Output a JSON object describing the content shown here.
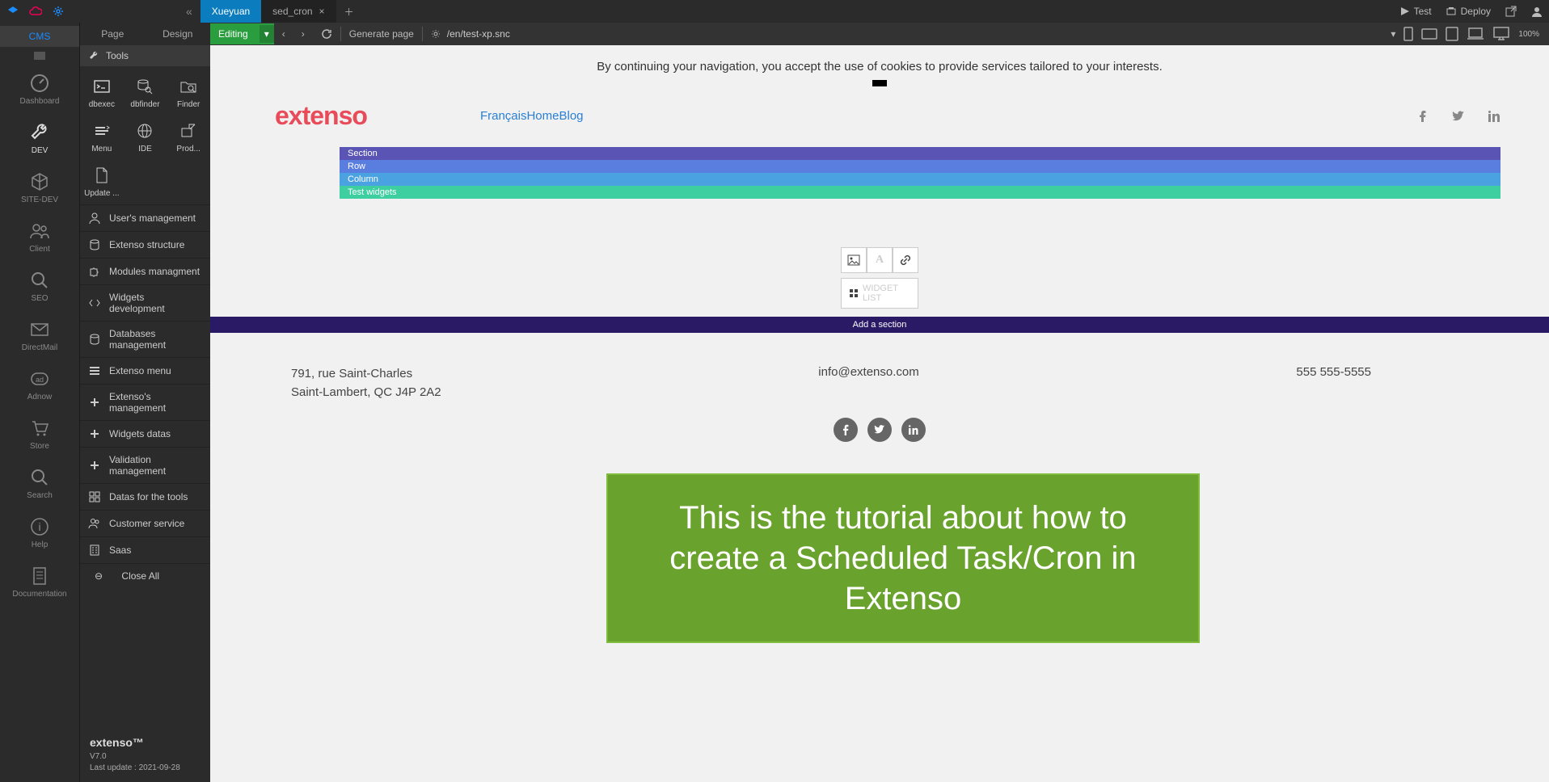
{
  "topbar": {
    "tabs": [
      {
        "label": "Xueyuan",
        "active": true,
        "closable": false
      },
      {
        "label": "sed_cron",
        "active": false,
        "closable": true
      }
    ],
    "actions": {
      "test": "Test",
      "deploy": "Deploy"
    },
    "hamburger_left": "«"
  },
  "leftrail": {
    "top_tab": "CMS",
    "items": [
      {
        "label": "Dashboard",
        "icon": "gauge-icon",
        "active": false
      },
      {
        "label": "DEV",
        "icon": "wrench-icon",
        "active": true
      },
      {
        "label": "SITE-DEV",
        "icon": "cube-icon",
        "active": false
      },
      {
        "label": "Client",
        "icon": "users-icon",
        "active": false
      },
      {
        "label": "SEO",
        "icon": "magnifier-icon",
        "active": false
      },
      {
        "label": "DirectMail",
        "icon": "mail-icon",
        "active": false
      },
      {
        "label": "Adnow",
        "icon": "ad-icon",
        "active": false
      },
      {
        "label": "Store",
        "icon": "cart-icon",
        "active": false
      },
      {
        "label": "Search",
        "icon": "search-icon",
        "active": false
      },
      {
        "label": "Help",
        "icon": "info-icon",
        "active": false
      },
      {
        "label": "Documentation",
        "icon": "doc-icon",
        "active": false
      }
    ]
  },
  "subtabs": {
    "page": "Page",
    "design": "Design"
  },
  "tools": {
    "header": "Tools",
    "grid": [
      {
        "label": "dbexec",
        "icon": "terminal-icon"
      },
      {
        "label": "dbfinder",
        "icon": "db-search-icon"
      },
      {
        "label": "Finder",
        "icon": "folder-search-icon"
      },
      {
        "label": "Menu",
        "icon": "menu-icon"
      },
      {
        "label": "IDE",
        "icon": "globe-icon"
      },
      {
        "label": "Prod...",
        "icon": "export-icon"
      },
      {
        "label": "Update ...",
        "icon": "file-icon"
      }
    ],
    "list": [
      {
        "label": "User's management",
        "icon": "user-icon"
      },
      {
        "label": "Extenso structure",
        "icon": "db-icon"
      },
      {
        "label": "Modules managment",
        "icon": "puzzle-icon"
      },
      {
        "label": "Widgets development",
        "icon": "code-icon"
      },
      {
        "label": "Databases management",
        "icon": "db-icon"
      },
      {
        "label": "Extenso menu",
        "icon": "list-icon"
      },
      {
        "label": "Extenso's management",
        "icon": "plus-icon"
      },
      {
        "label": "Widgets datas",
        "icon": "plus-icon"
      },
      {
        "label": "Validation management",
        "icon": "plus-icon"
      },
      {
        "label": "Datas for the tools",
        "icon": "grid-icon"
      },
      {
        "label": "Customer service",
        "icon": "users-icon"
      },
      {
        "label": "Saas",
        "icon": "building-icon"
      }
    ],
    "close_all": "Close All"
  },
  "brand": {
    "name": "extenso™",
    "version": "V7.0",
    "updated": "Last update : 2021-09-28"
  },
  "maintoolbar": {
    "editing": "Editing",
    "generate": "Generate page",
    "path": "/en/test-xp.snc",
    "zoom": "100%"
  },
  "page": {
    "cookie": "By continuing your navigation, you accept the use of cookies to provide services tailored to your interests.",
    "logo": "extenso",
    "nav": {
      "lang": "Français",
      "home": "Home",
      "blog": "Blog"
    },
    "layout": {
      "section": "Section",
      "row": "Row",
      "column": "Column",
      "test": "Test widgets"
    },
    "widget_list": "WIDGET LIST",
    "add_section": "Add a section",
    "footer": {
      "addr1": "791, rue Saint-Charles",
      "addr2": "Saint-Lambert, QC J4P 2A2",
      "email": "info@extenso.com",
      "phone": "555 555-5555"
    }
  },
  "tutorial": "This is the tutorial about how to create a Scheduled Task/Cron in Extenso"
}
